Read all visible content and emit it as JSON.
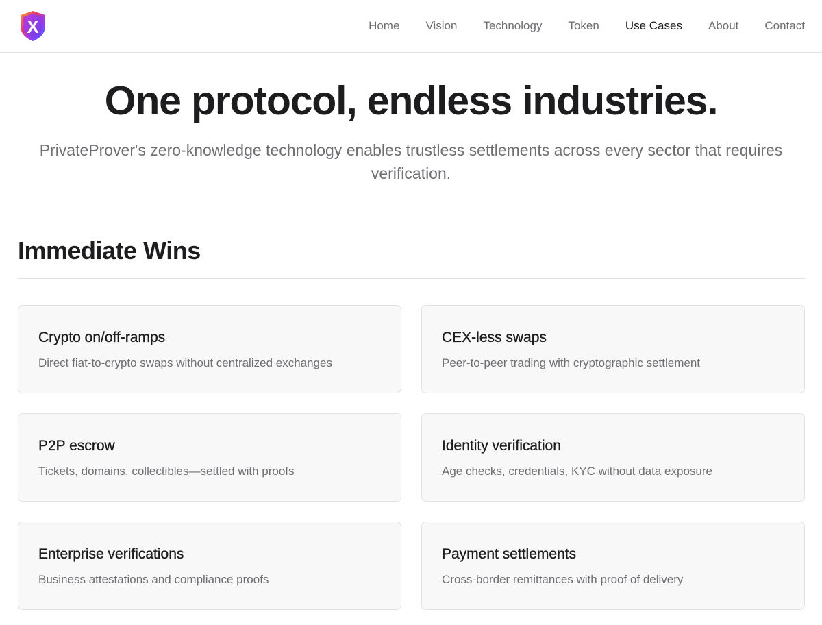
{
  "brand": {
    "logo_letter": "X",
    "accent_gradient": [
      "#f5a623",
      "#e8366d",
      "#8a3ffc",
      "#3a6ff7"
    ]
  },
  "nav": {
    "items": [
      {
        "label": "Home"
      },
      {
        "label": "Vision"
      },
      {
        "label": "Technology"
      },
      {
        "label": "Token"
      },
      {
        "label": "Use Cases",
        "active": true
      },
      {
        "label": "About"
      },
      {
        "label": "Contact"
      }
    ]
  },
  "hero": {
    "title": "One protocol, endless industries.",
    "subtitle": "PrivateProver's zero-knowledge technology enables trustless settlements across every sector that requires verification."
  },
  "section": {
    "title": "Immediate Wins"
  },
  "cards": [
    {
      "title": "Crypto on/off-ramps",
      "description": "Direct fiat-to-crypto swaps without centralized exchanges"
    },
    {
      "title": "CEX-less swaps",
      "description": "Peer-to-peer trading with cryptographic settlement"
    },
    {
      "title": "P2P escrow",
      "description": "Tickets, domains, collectibles—settled with proofs"
    },
    {
      "title": "Identity verification",
      "description": "Age checks, credentials, KYC without data exposure"
    },
    {
      "title": "Enterprise verifications",
      "description": "Business attestations and compliance proofs"
    },
    {
      "title": "Payment settlements",
      "description": "Cross-border remittances with proof of delivery"
    }
  ]
}
